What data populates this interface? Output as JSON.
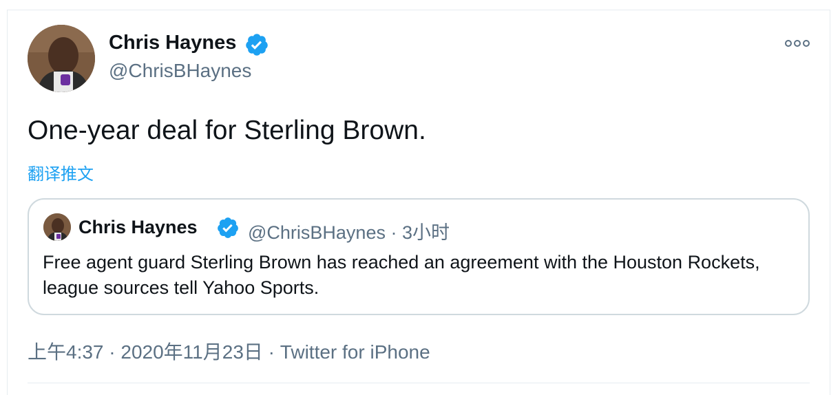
{
  "tweet": {
    "author_name": "Chris Haynes",
    "author_handle": "@ChrisBHaynes",
    "text": "One-year deal for Sterling Brown.",
    "translate_label": "翻译推文",
    "more_icon": "more-horizontal-icon",
    "verified_icon": "verified-badge-icon"
  },
  "quoted_tweet": {
    "author_name": "Chris Haynes",
    "meta": "@ChrisBHaynes · 3小时",
    "text": "Free agent guard Sterling Brown has reached an agreement with the Houston Rockets, league sources tell Yahoo Sports."
  },
  "meta": {
    "time": "上午4:37",
    "separator": " · ",
    "date": "2020年11月23日",
    "source": "Twitter for iPhone"
  },
  "colors": {
    "accent": "#1da1f2",
    "secondary_text": "#5b7083",
    "border": "#cfd9de"
  }
}
